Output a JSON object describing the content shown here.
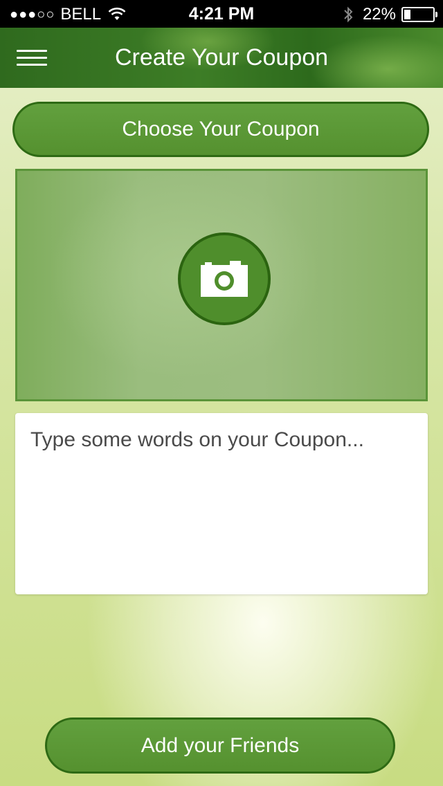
{
  "status_bar": {
    "signal_dots": "●●●○○",
    "carrier": "BELL",
    "time": "4:21 PM",
    "battery_percent": "22%",
    "battery_level": 0.22
  },
  "navbar": {
    "title": "Create Your Coupon",
    "menu_icon": "hamburger-menu-icon"
  },
  "choose_button": {
    "label": "Choose Your Coupon"
  },
  "photo": {
    "icon": "camera-icon"
  },
  "coupon_text": {
    "placeholder": "Type some words on your Coupon...",
    "value": ""
  },
  "friends_button": {
    "label": "Add your Friends"
  },
  "colors": {
    "primary_green": "#55912f",
    "dark_green_border": "#2e6a14",
    "nav_green": "#3d7d26"
  }
}
